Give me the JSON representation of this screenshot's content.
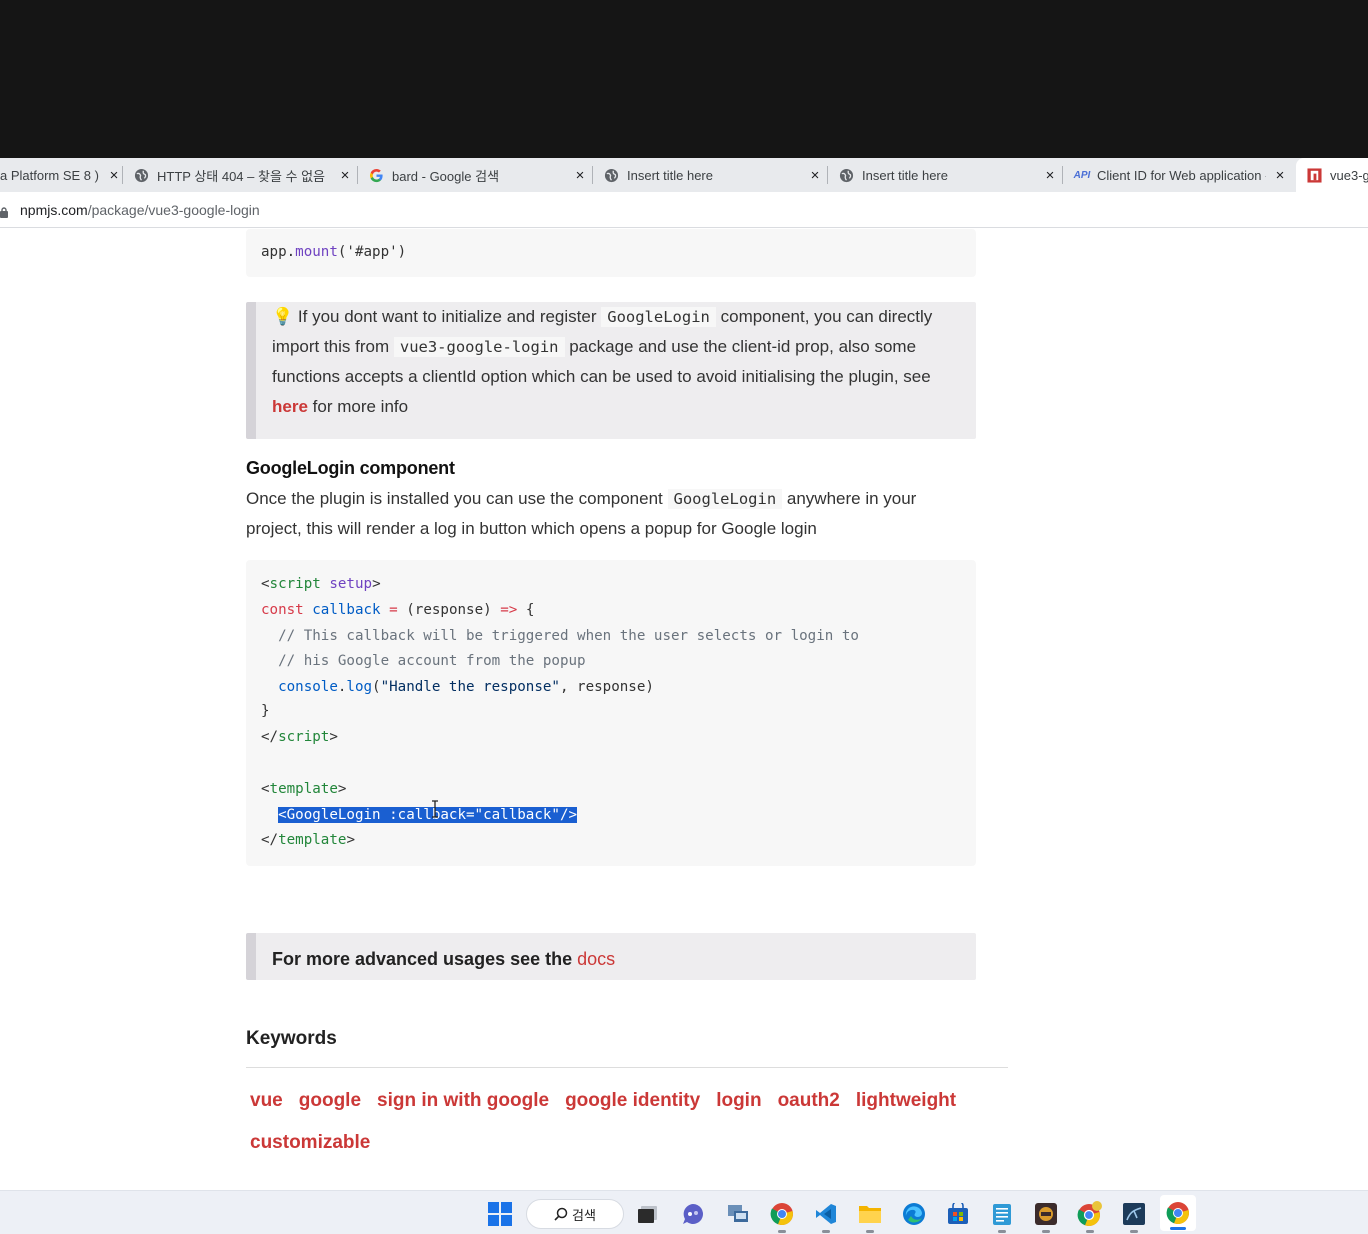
{
  "browser": {
    "tabs": [
      {
        "title": "a Platform SE 8 )",
        "icon": "none",
        "close": "×"
      },
      {
        "title": "HTTP 상태 404 – 찾을 수 없음",
        "icon": "globe-icon",
        "close": "×"
      },
      {
        "title": "bard - Google 검색",
        "icon": "google-icon",
        "close": "×"
      },
      {
        "title": "Insert title here",
        "icon": "globe-icon",
        "close": "×"
      },
      {
        "title": "Insert title here",
        "icon": "globe-icon",
        "close": "×"
      },
      {
        "title": "Client ID for Web application -",
        "icon": "api-icon",
        "icon_text": "API",
        "close": "×"
      },
      {
        "title": "vue3-g",
        "icon": "npm-icon",
        "close": ""
      }
    ],
    "address": {
      "host": "npmjs.com",
      "path": "/package/vue3-google-login"
    }
  },
  "content": {
    "code1": {
      "line1_obj": "app",
      "line1_dot": ".",
      "line1_fn": "mount",
      "line1_args": "('#app')"
    },
    "note1": {
      "emoji": "💡",
      "t1": " If you dont want to initialize and register ",
      "c1": "GoogleLogin",
      "t2": " component, you can directly import this from ",
      "c2": "vue3-google-login",
      "t3": " package and use the client-id prop, also some functions accepts a clientId option which can be used to avoid initialising the plugin, see ",
      "link": "here",
      "t4": " for more info"
    },
    "section": {
      "heading": "GoogleLogin component",
      "p1": "Once the plugin is installed you can use the component ",
      "pc": "GoogleLogin",
      "p2": " anywhere in your project, this will render a log in button which opens a popup for Google login"
    },
    "code2": {
      "l1_a": "<",
      "l1_tag": "script",
      "l1_sp": " ",
      "l1_attr": "setup",
      "l1_b": ">",
      "l2_kw": "const",
      "l2_sp": " ",
      "l2_fn": "callback",
      "l2_eq": " = ",
      "l2_rest": "(response) ",
      "l2_arrow": "=>",
      "l2_end": " {",
      "l3": "  // This callback will be triggered when the user selects or login to",
      "l4": "  // his Google account from the popup",
      "l5_obj": "  console",
      "l5_dot": ".",
      "l5_fn": "log",
      "l5_open": "(",
      "l5_str": "\"Handle the response\"",
      "l5_rest": ", response)",
      "l6": "}",
      "l7_a": "</",
      "l7_tag": "script",
      "l7_b": ">",
      "l8_a": "<",
      "l8_tag": "template",
      "l8_b": ">",
      "l9_indent": "  ",
      "l9_sel": "<GoogleLogin :callback=\"callback\"/>",
      "l10_a": "</",
      "l10_tag": "template",
      "l10_b": ">"
    },
    "note2": {
      "text": "For more advanced usages see the ",
      "link": "docs"
    },
    "keywords": {
      "heading": "Keywords",
      "items": [
        "vue",
        "google",
        "sign in with google",
        "google identity",
        "login",
        "oauth2",
        "lightweight",
        "customizable"
      ]
    }
  },
  "taskbar": {
    "search_label": "검색",
    "icons": [
      "windows-start-icon",
      "search-icon",
      "task-view-icon",
      "chat-icon",
      "network-app-icon",
      "chrome-icon",
      "vscode-icon",
      "file-explorer-icon",
      "edge-icon",
      "store-icon",
      "notepad-icon",
      "eclipse-ide-icon",
      "chrome-canary-icon",
      "mysql-workbench-icon",
      "chrome-active-icon"
    ]
  },
  "colors": {
    "npm_red": "#cb3837",
    "selection": "#1a5fd1",
    "code_bg": "#f7f7f7",
    "note_bg": "#eeedef"
  }
}
